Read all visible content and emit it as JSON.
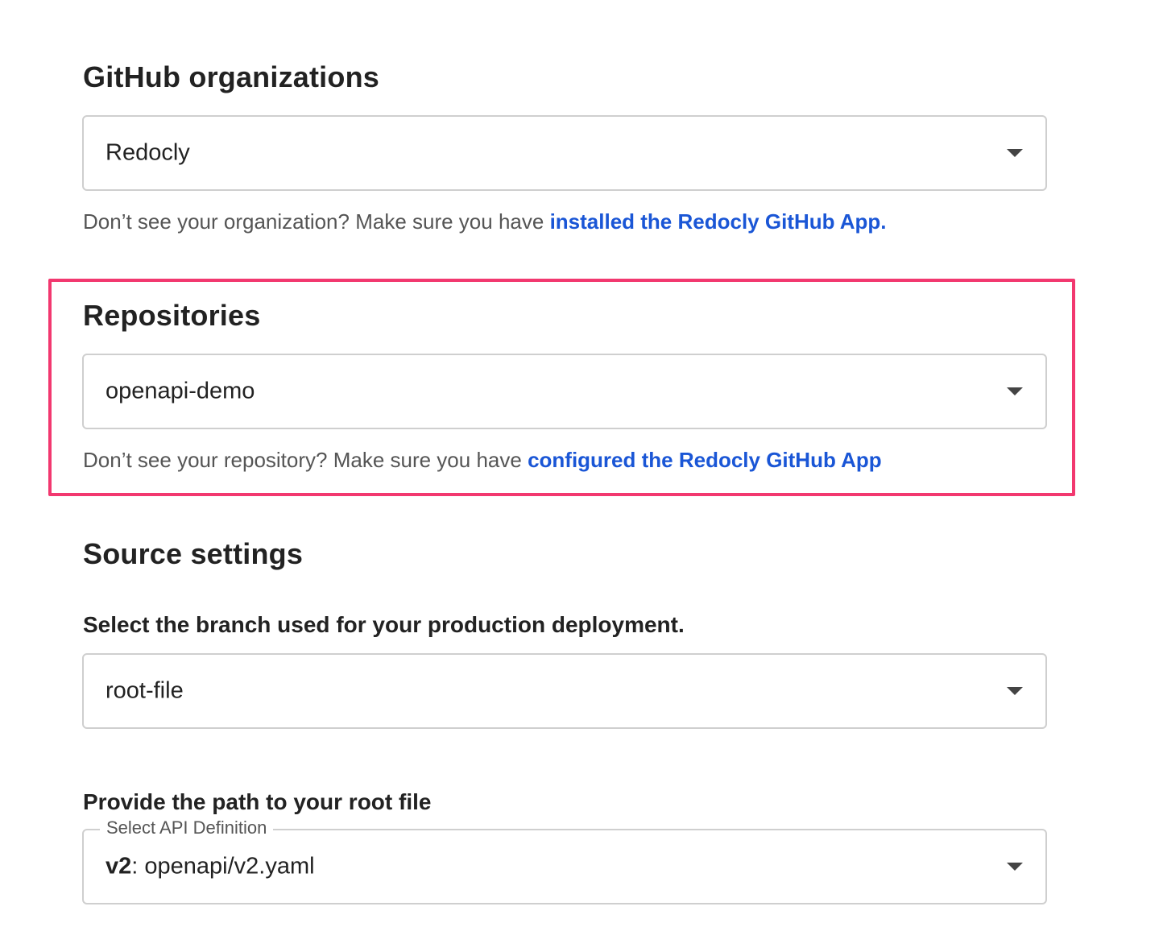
{
  "github_orgs": {
    "heading": "GitHub organizations",
    "selected": "Redocly",
    "helper_text": "Don’t see your organization? Make sure you have ",
    "helper_link": "installed the Redocly GitHub App."
  },
  "repositories": {
    "heading": "Repositories",
    "selected": "openapi-demo",
    "helper_text": "Don’t see your repository? Make sure you have ",
    "helper_link": "configured the Redocly GitHub App"
  },
  "source_settings": {
    "heading": "Source settings",
    "branch_label": "Select the branch used for your production deployment.",
    "branch_selected": "root-file",
    "root_label": "Provide the path to your root file",
    "api_select_legend": "Select API Definition",
    "api_selected_key": "v2",
    "api_selected_value": ": openapi/v2.yaml"
  },
  "colors": {
    "highlight": "#f2386f",
    "link": "#1a56d6"
  },
  "icons": {
    "dropdown": "caret-down-icon"
  }
}
